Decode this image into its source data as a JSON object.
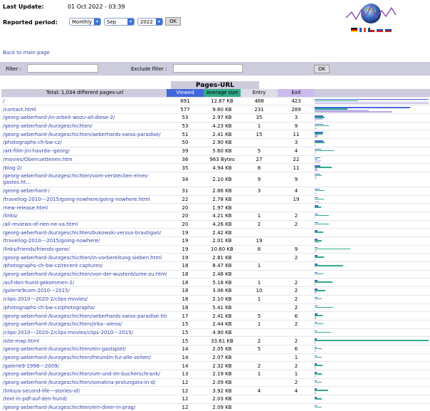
{
  "header": {
    "last_update_label": "Last Update:",
    "last_update_value": "01 Oct 2022 - 03:39",
    "period_label": "Reported period:",
    "period_type": "Monthly",
    "month": "Sep",
    "year": "2022",
    "ok": "OK",
    "colors": {
      "arrow": "#3b73d8"
    },
    "flags": [
      "de-flag-icon",
      "fr-flag-icon",
      "cz-flag-icon",
      "sk-flag-icon",
      "ru-flag-icon"
    ]
  },
  "back_link": "Back to main page",
  "filter": {
    "filter_label": "Filter :",
    "exclude_label": "Exclude filter :",
    "ok": "OK"
  },
  "table": {
    "title": "Pages-URL",
    "total": "Total: 1,034 different pages-url",
    "cols": {
      "viewed": "Viewed",
      "avg": "Average size",
      "entry": "Entry",
      "exit": "Exit"
    },
    "colors": {
      "viewed": "#4466dd",
      "avg": "#33aa88",
      "entry": "#bbbbee",
      "exit": "#bbaadd"
    },
    "max": {
      "viewed": 691,
      "avg_kb": 33.61,
      "entry": 488,
      "exit": 423
    },
    "rows": [
      {
        "url": "/",
        "viewed": 691,
        "avg": "12.87 KB",
        "avg_kb": 12.87,
        "entry": "488",
        "exit": "423"
      },
      {
        "url": "/contact.html",
        "viewed": 577,
        "avg": "9.60 KB",
        "avg_kb": 9.6,
        "entry": "231",
        "exit": "289"
      },
      {
        "url": "/georg-aeberhard-/in-arbeit-wozu-all-diese-2/",
        "viewed": 53,
        "avg": "2.97 KB",
        "avg_kb": 2.97,
        "entry": "35",
        "exit": "3"
      },
      {
        "url": "/georg-aeberhard-/kurzgeschichten/",
        "viewed": 53,
        "avg": "4.23 KB",
        "avg_kb": 4.23,
        "entry": "1",
        "exit": "9"
      },
      {
        "url": "/georg-aeberhard-/kurzgeschichten/aeberhards-swiss-paradise/",
        "viewed": 51,
        "avg": "2.41 KB",
        "avg_kb": 2.41,
        "entry": "15",
        "exit": "11"
      },
      {
        "url": "/photographs-ch-bw-cz/",
        "viewed": 50,
        "avg": "2.90 KB",
        "avg_kb": 2.9,
        "entry": "",
        "exit": "3"
      },
      {
        "url": "/art-film-jiri-havrda--georg/",
        "viewed": 39,
        "avg": "5.60 KB",
        "avg_kb": 5.6,
        "entry": "5",
        "exit": "4"
      },
      {
        "url": "/movies/Oberruettenen.htm",
        "viewed": 36,
        "avg": "963 Bytes",
        "avg_kb": 0.94,
        "entry": "27",
        "exit": "22"
      },
      {
        "url": "/blog-2/",
        "viewed": 35,
        "avg": "4.94 KB",
        "avg_kb": 4.94,
        "entry": "8",
        "exit": "11"
      },
      {
        "url": "/georg-aeberhard-/kurzgeschichten/vom-verstecken-eines-",
        "url2": "gastes.ht...",
        "viewed": 34,
        "avg": "2.10 KB",
        "avg_kb": 2.1,
        "entry": "9",
        "exit": "9"
      },
      {
        "url": "/georg-aeberhard-/",
        "viewed": 31,
        "avg": "2.86 KB",
        "avg_kb": 2.86,
        "entry": "3",
        "exit": "4"
      },
      {
        "url": "/travellog-2010---2015/going-nowhere/going-nowhere.html",
        "viewed": 22,
        "avg": "2.78 KB",
        "avg_kb": 2.78,
        "entry": "",
        "exit": "19"
      },
      {
        "url": "/new-release.html",
        "viewed": 20,
        "avg": "1.97 KB",
        "avg_kb": 1.97,
        "entry": "",
        "exit": ""
      },
      {
        "url": "/links/",
        "viewed": 20,
        "avg": "4.21 KB",
        "avg_kb": 4.21,
        "entry": "1",
        "exit": "2"
      },
      {
        "url": "/all-reviews-of-rien-ne-va.html",
        "viewed": 20,
        "avg": "4.26 KB",
        "avg_kb": 4.26,
        "entry": "2",
        "exit": "2"
      },
      {
        "url": "/georg-aeberhard-/kurzgeschichten/bukowski-versus-brautigan/",
        "viewed": 19,
        "avg": "2.42 KB",
        "avg_kb": 2.42,
        "entry": "",
        "exit": ""
      },
      {
        "url": "/travellog-2010---2015/going-nowhere/",
        "viewed": 19,
        "avg": "2.01 KB",
        "avg_kb": 2.01,
        "entry": "19",
        "exit": ""
      },
      {
        "url": "/links/friends/friends-gone/",
        "viewed": 19,
        "avg": "10.60 KB",
        "avg_kb": 10.6,
        "entry": "8",
        "exit": "9"
      },
      {
        "url": "/georg-aeberhard-/kurzgeschichten/in-vorbereitung-sieben.html",
        "viewed": 19,
        "avg": "2.81 KB",
        "avg_kb": 2.81,
        "entry": "",
        "exit": "2"
      },
      {
        "url": "/photographs-ch-bw-cz/recent-captures/",
        "viewed": 18,
        "avg": "8.47 KB",
        "avg_kb": 8.47,
        "entry": "1",
        "exit": ""
      },
      {
        "url": "/georg-aeberhard-/kurzgeschichten/von-der-wustenblume-zu.html",
        "viewed": 18,
        "avg": "2.48 KB",
        "avg_kb": 2.48,
        "entry": "",
        "exit": ""
      },
      {
        "url": "/auf-den-hund-gekommen-2/",
        "viewed": 18,
        "avg": "5.18 KB",
        "avg_kb": 5.18,
        "entry": "1",
        "exit": "2"
      },
      {
        "url": "/galerie9com-2010---2015/",
        "viewed": 18,
        "avg": "3.06 KB",
        "avg_kb": 3.06,
        "entry": "10",
        "exit": "2"
      },
      {
        "url": "/clips-2010---2020-2/clips-movies/",
        "viewed": 18,
        "avg": "2.10 KB",
        "avg_kb": 2.1,
        "entry": "1",
        "exit": "2"
      },
      {
        "url": "/photographs-ch-bw-cz/photographs/",
        "viewed": 18,
        "avg": "5.41 KB",
        "avg_kb": 5.41,
        "entry": "",
        "exit": "2"
      },
      {
        "url": "/georg-aeberhard-/kurzgeschichten/aeberhards-swiss-paradise.html",
        "viewed": 17,
        "avg": "2.41 KB",
        "avg_kb": 2.41,
        "entry": "5",
        "exit": "6"
      },
      {
        "url": "/georg-aeberhard-/kurzgeschichten/jirka--alena/",
        "viewed": 15,
        "avg": "2.44 KB",
        "avg_kb": 2.44,
        "entry": "1",
        "exit": "2"
      },
      {
        "url": "/clips-2010---2020-2/clips-movies/clips-2010---2015/",
        "viewed": 15,
        "avg": "4.90 KB",
        "avg_kb": 4.9,
        "entry": "",
        "exit": ""
      },
      {
        "url": "/site-map.html",
        "viewed": 15,
        "avg": "33.61 KB",
        "avg_kb": 33.61,
        "entry": "2",
        "exit": "2"
      },
      {
        "url": "/georg-aeberhard-/kurzgeschichten/ein-gastspiel/",
        "viewed": 14,
        "avg": "2.05 KB",
        "avg_kb": 2.05,
        "entry": "5",
        "exit": "6"
      },
      {
        "url": "/georg-aeberhard-/kurzgeschichten/freundin-fur-alle-zeiten/",
        "viewed": 14,
        "avg": "2.07 KB",
        "avg_kb": 2.07,
        "entry": "",
        "exit": "1"
      },
      {
        "url": "/galerie9-1998---2009/",
        "viewed": 14,
        "avg": "2.32 KB",
        "avg_kb": 2.32,
        "entry": "2",
        "exit": "2"
      },
      {
        "url": "/georg-aeberhard-/kurzgeschichten/um-und-im-bucherschrank/",
        "viewed": 13,
        "avg": "2.19 KB",
        "avg_kb": 2.19,
        "entry": "1",
        "exit": "1"
      },
      {
        "url": "/georg-aeberhard-/kurzgeschichten/sonatina-prolungata-in-d/",
        "viewed": 12,
        "avg": "2.09 KB",
        "avg_kb": 2.09,
        "entry": "",
        "exit": "2"
      },
      {
        "url": "/links/a-second-life---stories-of/",
        "viewed": 12,
        "avg": "3.92 KB",
        "avg_kb": 3.92,
        "entry": "4",
        "exit": "4"
      },
      {
        "url": "/text-in-pdf-auf-den-hund/",
        "viewed": 12,
        "avg": "2.03 KB",
        "avg_kb": 2.03,
        "entry": "",
        "exit": ""
      },
      {
        "url": "/georg-aeberhard-/kurzgeschichten/ein-diner-in-prag/",
        "viewed": 12,
        "avg": "2.09 KB",
        "avg_kb": 2.09,
        "entry": "",
        "exit": ""
      }
    ]
  }
}
